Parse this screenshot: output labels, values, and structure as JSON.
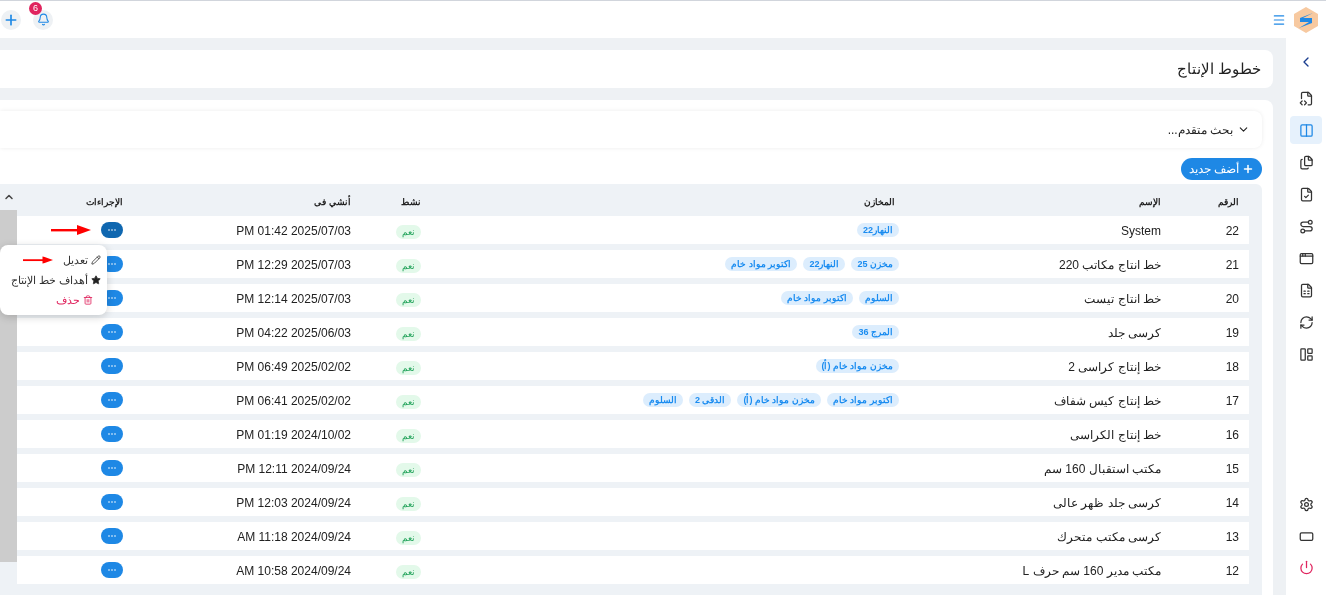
{
  "topbar": {
    "notifications": "6"
  },
  "sidebar": {
    "items": [
      {
        "selected": false
      },
      {
        "selected": true
      },
      {
        "selected": false
      },
      {
        "selected": false
      },
      {
        "selected": false
      },
      {
        "selected": false
      },
      {
        "selected": false
      },
      {
        "selected": false
      },
      {
        "selected": false
      }
    ]
  },
  "page_title": "خطوط الإنتاج",
  "search": {
    "label": "بحث متقدم..."
  },
  "add_button": "أضف جديد",
  "table": {
    "columns": [
      "الرقم",
      "الإسم",
      "المخازن",
      "نشط",
      "أنشي فى",
      "الإجراءات"
    ],
    "rows": [
      {
        "number": "22",
        "name": "System",
        "warehouses": [
          "النهار22"
        ],
        "active": "نعم",
        "created": "PM 01:42 2025/07/03",
        "menu_open": true
      },
      {
        "number": "21",
        "name": "خط انتاج مكاتب 220",
        "warehouses": [
          "مخزن 25",
          "النهار22",
          "اكتوبر مواد خام"
        ],
        "active": "نعم",
        "created": "PM 12:29 2025/07/03",
        "menu_open": false
      },
      {
        "number": "20",
        "name": "خط انتاج تيست",
        "warehouses": [
          "السلوم",
          "اكتوبر مواد خام"
        ],
        "active": "نعم",
        "created": "PM 12:14 2025/07/03",
        "menu_open": false
      },
      {
        "number": "19",
        "name": "كرسى جلد",
        "warehouses": [
          "المرج 36"
        ],
        "active": "نعم",
        "created": "PM 04:22 2025/06/03",
        "menu_open": false
      },
      {
        "number": "18",
        "name": "خط إنتاج كراسى 2",
        "warehouses": [
          "مخزن مواد خام (أ)"
        ],
        "active": "نعم",
        "created": "PM 06:49 2025/02/02",
        "menu_open": false
      },
      {
        "number": "17",
        "name": "خط إنتاج كيس شفاف",
        "warehouses": [
          "اكتوبر مواد خام",
          "مخزن مواد خام (أ)",
          "الدقى 2",
          "السلوم"
        ],
        "active": "نعم",
        "created": "PM 06:41 2025/02/02",
        "menu_open": false
      },
      {
        "number": "16",
        "name": "خط إنتاج الكراسى",
        "warehouses": [],
        "active": "نعم",
        "created": "PM 01:19 2024/10/02",
        "menu_open": false
      },
      {
        "number": "15",
        "name": "مكتب استقبال 160 سم",
        "warehouses": [],
        "active": "نعم",
        "created": "PM 12:11 2024/09/24",
        "menu_open": false
      },
      {
        "number": "14",
        "name": "كرسى جلد ظهر عالى",
        "warehouses": [],
        "active": "نعم",
        "created": "PM 12:03 2024/09/24",
        "menu_open": false
      },
      {
        "number": "13",
        "name": "كرسى مكتب متحرك",
        "warehouses": [],
        "active": "نعم",
        "created": "AM 11:18 2024/09/24",
        "menu_open": false
      },
      {
        "number": "12",
        "name": "مكتب مدير 160 سم حرف L",
        "warehouses": [],
        "active": "نعم",
        "created": "AM 10:58 2024/09/24",
        "menu_open": false
      }
    ]
  },
  "action_menu": {
    "items": [
      {
        "kind": "edit",
        "label": "تعديل"
      },
      {
        "kind": "targets",
        "label": "أهداف خط الإنتاج"
      },
      {
        "kind": "delete",
        "label": "حذف"
      }
    ]
  }
}
